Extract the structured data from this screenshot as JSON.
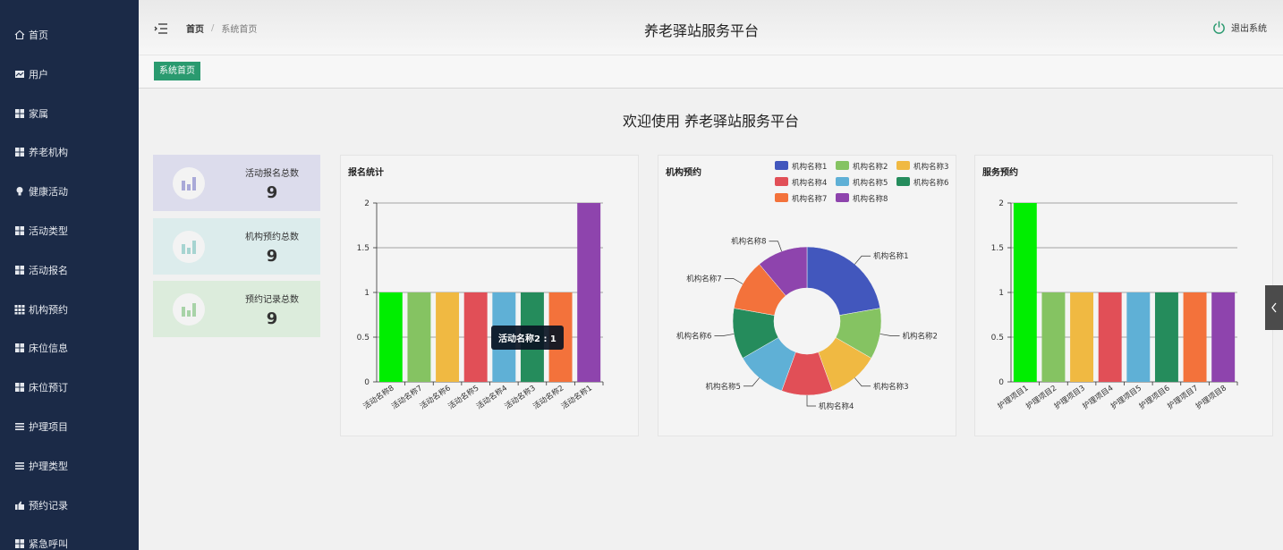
{
  "sidebar": {
    "items": [
      {
        "label": "首页",
        "icon": "home-icon"
      },
      {
        "label": "用户",
        "icon": "user-chart-icon"
      },
      {
        "label": "家属",
        "icon": "grid-icon"
      },
      {
        "label": "养老机构",
        "icon": "grid-icon"
      },
      {
        "label": "健康活动",
        "icon": "lightbulb-icon"
      },
      {
        "label": "活动类型",
        "icon": "grid-icon"
      },
      {
        "label": "活动报名",
        "icon": "grid-icon"
      },
      {
        "label": "机构预约",
        "icon": "grid9-icon"
      },
      {
        "label": "床位信息",
        "icon": "grid-icon"
      },
      {
        "label": "床位预订",
        "icon": "grid-icon"
      },
      {
        "label": "护理项目",
        "icon": "list-icon"
      },
      {
        "label": "护理类型",
        "icon": "list-icon"
      },
      {
        "label": "预约记录",
        "icon": "thumb-icon"
      },
      {
        "label": "紧急呼叫",
        "icon": "grid-icon"
      }
    ]
  },
  "header": {
    "home": "首页",
    "current": "系统首页",
    "title": "养老驿站服务平台",
    "logout": "退出系统"
  },
  "tabs": {
    "active": "系统首页"
  },
  "welcome": "欢迎使用 养老驿站服务平台",
  "stats": [
    {
      "label": "活动报名总数",
      "value": "9",
      "bg": "#dcdcec",
      "icon_color": "#a9a9d8"
    },
    {
      "label": "机构预约总数",
      "value": "9",
      "bg": "#dcecec",
      "icon_color": "#a7d4d1"
    },
    {
      "label": "预约记录总数",
      "value": "9",
      "bg": "#dcecdc",
      "icon_color": "#a8d3a8"
    }
  ],
  "tooltip": "活动名称2 : 1",
  "chart_data": [
    {
      "type": "bar",
      "title": "报名统计",
      "categories": [
        "活动名称8",
        "活动名称7",
        "活动名称6",
        "活动名称5",
        "活动名称4",
        "活动名称3",
        "活动名称2",
        "活动名称1"
      ],
      "values": [
        1,
        1,
        1,
        1,
        1,
        1,
        1,
        2
      ],
      "colors": [
        "#00ee00",
        "#85c362",
        "#f0b942",
        "#e14f57",
        "#5fb0d6",
        "#258c5c",
        "#f3723b",
        "#8e44ad"
      ],
      "ylim": [
        0,
        2
      ],
      "yticks": [
        "0",
        "0.5",
        "1",
        "1.5",
        "2"
      ]
    },
    {
      "type": "pie",
      "title": "机构预约",
      "labels": [
        "机构名称1",
        "机构名称2",
        "机构名称3",
        "机构名称4",
        "机构名称5",
        "机构名称6",
        "机构名称7",
        "机构名称8"
      ],
      "values": [
        2,
        1,
        1,
        1,
        1,
        1,
        1,
        1
      ],
      "colors": [
        "#4257bd",
        "#85c362",
        "#f0b942",
        "#e14f57",
        "#5fb0d6",
        "#258c5c",
        "#f3723b",
        "#8e44ad"
      ],
      "legend": "top-right"
    },
    {
      "type": "bar",
      "title": "服务预约",
      "categories": [
        "护理项目1",
        "护理项目2",
        "护理项目3",
        "护理项目4",
        "护理项目5",
        "护理项目6",
        "护理项目7",
        "护理项目8"
      ],
      "values": [
        2,
        1,
        1,
        1,
        1,
        1,
        1,
        1
      ],
      "colors": [
        "#00ee00",
        "#85c362",
        "#f0b942",
        "#e14f57",
        "#5fb0d6",
        "#258c5c",
        "#f3723b",
        "#8e44ad"
      ],
      "ylim": [
        0,
        2
      ],
      "yticks": [
        "0",
        "0.5",
        "1",
        "1.5",
        "2"
      ]
    }
  ]
}
